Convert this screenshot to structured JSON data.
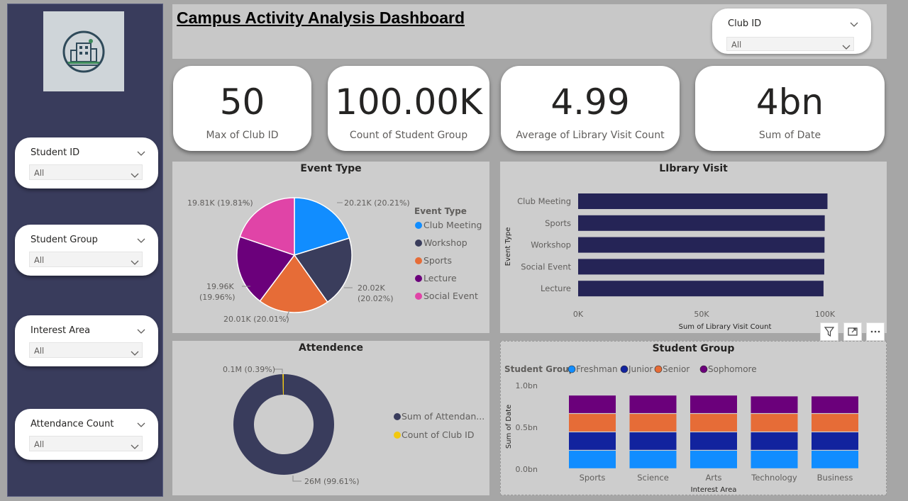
{
  "title": "Campus Activity Analysis Dashboard",
  "club_slicer": {
    "label": "Club ID",
    "value": "All"
  },
  "slicers": [
    {
      "label": "Student ID",
      "value": "All"
    },
    {
      "label": "Student Group",
      "value": "All"
    },
    {
      "label": "Interest Area",
      "value": "All"
    },
    {
      "label": "Attendance Count",
      "value": "All"
    }
  ],
  "kpis": [
    {
      "value": "50",
      "label": "Max of Club ID"
    },
    {
      "value": "100.00K",
      "label": "Count of Student Group"
    },
    {
      "value": "4.99",
      "label": "Average of Library Visit Count"
    },
    {
      "value": "4bn",
      "label": "Sum of Date"
    }
  ],
  "event_type": {
    "title": "Event Type",
    "legend_title": "Event Type",
    "legend": [
      "Club Meeting",
      "Workshop",
      "Sports",
      "Lecture",
      "Social Event"
    ],
    "labels": [
      "20.21K (20.21%)",
      "20.02K",
      "(20.02%)",
      "20.01K (20.01%)",
      "19.96K",
      "(19.96%)",
      "19.81K (19.81%)"
    ],
    "colors": [
      "#118dff",
      "#3a3d5c",
      "#e66c37",
      "#6b007b",
      "#e044a7"
    ]
  },
  "library_visit": {
    "title": "LIbrary Visit",
    "ylabel": "Event Type",
    "xlabel": "Sum of Library Visit Count",
    "categories": [
      "Club Meeting",
      "Sports",
      "Workshop",
      "Social Event",
      "Lecture"
    ],
    "ticks": [
      "0K",
      "50K",
      "100K"
    ]
  },
  "attendance": {
    "title": "Attendence",
    "labels": [
      "0.1M (0.39%)",
      "26M (99.61%)"
    ],
    "legend": [
      "Sum of Attendan...",
      "Count of Club ID"
    ],
    "colors": [
      "#393c5c",
      "#f2c80f"
    ]
  },
  "student_group": {
    "title": "Student Group",
    "legend_title": "Student Group",
    "legend": [
      "Freshman",
      "Junior",
      "Senior",
      "Sophomore"
    ],
    "ylabel": "Sum of Date",
    "xlabel": "Interest Area",
    "yticks": [
      "1.0bn",
      "0.5bn",
      "0.0bn"
    ],
    "colors": [
      "#118dff",
      "#12239e",
      "#e66c37",
      "#6b007b"
    ]
  },
  "chart_data": [
    {
      "type": "pie",
      "title": "Event Type",
      "categories": [
        "Club Meeting",
        "Workshop",
        "Sports",
        "Lecture",
        "Social Event"
      ],
      "values": [
        20210,
        20020,
        20010,
        19960,
        19810
      ],
      "percent": [
        20.21,
        20.02,
        20.01,
        19.96,
        19.81
      ]
    },
    {
      "type": "bar",
      "title": "LIbrary Visit",
      "orientation": "horizontal",
      "categories": [
        "Club Meeting",
        "Sports",
        "Workshop",
        "Social Event",
        "Lecture"
      ],
      "values": [
        101000,
        99900,
        99800,
        99700,
        99400
      ],
      "xlabel": "Sum of Library Visit Count",
      "ylabel": "Event Type",
      "xlim": [
        0,
        100000
      ]
    },
    {
      "type": "pie",
      "title": "Attendence",
      "donut": true,
      "categories": [
        "Sum of Attendan...",
        "Count of Club ID"
      ],
      "values": [
        26000000,
        100000
      ],
      "percent": [
        99.61,
        0.39
      ]
    },
    {
      "type": "bar",
      "title": "Student Group",
      "stacked": true,
      "categories": [
        "Sports",
        "Science",
        "Arts",
        "Technology",
        "Business"
      ],
      "series": [
        {
          "name": "Freshman",
          "values": [
            0.22,
            0.22,
            0.22,
            0.22,
            0.22
          ]
        },
        {
          "name": "Junior",
          "values": [
            0.22,
            0.22,
            0.22,
            0.22,
            0.22
          ]
        },
        {
          "name": "Senior",
          "values": [
            0.22,
            0.22,
            0.22,
            0.22,
            0.22
          ]
        },
        {
          "name": "Sophomore",
          "values": [
            0.22,
            0.22,
            0.22,
            0.21,
            0.21
          ]
        }
      ],
      "xlabel": "Interest Area",
      "ylabel": "Sum of Date",
      "ylim": [
        0,
        1.0
      ]
    }
  ]
}
